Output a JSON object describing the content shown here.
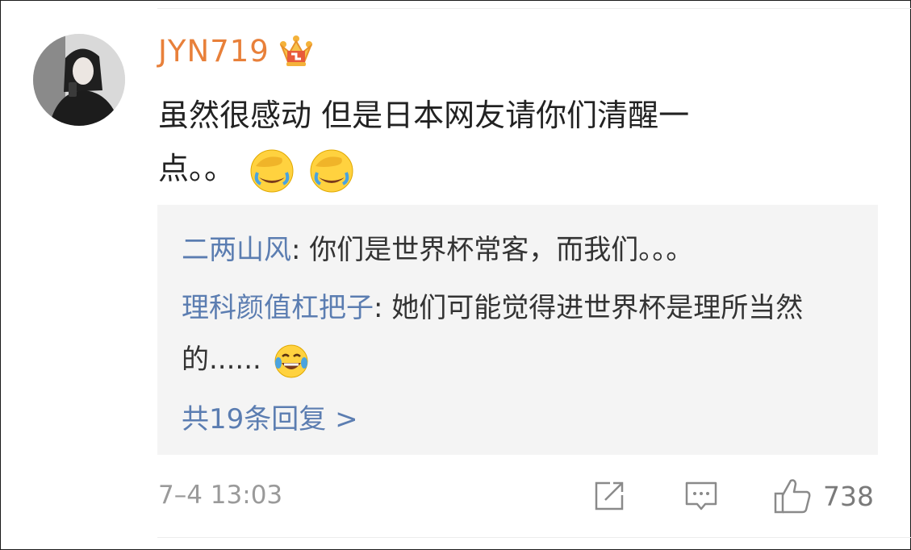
{
  "comment": {
    "username": "JYN719",
    "text_line1": "虽然很感动 但是日本网友请你们清醒一",
    "text_line2": "点。。",
    "emojis": [
      "facepalm-cry-emoji",
      "facepalm-cry-emoji"
    ]
  },
  "replies": [
    {
      "user": "二两山风",
      "text": ": 你们是世界杯常客，而我们。。。"
    },
    {
      "user": "理科颜值杠把子",
      "text": ": 她们可能觉得进世界杯是理所当然的......",
      "emoji": "laugh-cry-emoji"
    }
  ],
  "more_replies_label": "共19条回复 >",
  "footer": {
    "timestamp": "7–4 13:03",
    "like_count": "738"
  },
  "colors": {
    "username": "#e8803a",
    "reply_user": "#5b7db1",
    "reply_bg": "#f4f4f4",
    "meta": "#9a9a9a"
  }
}
